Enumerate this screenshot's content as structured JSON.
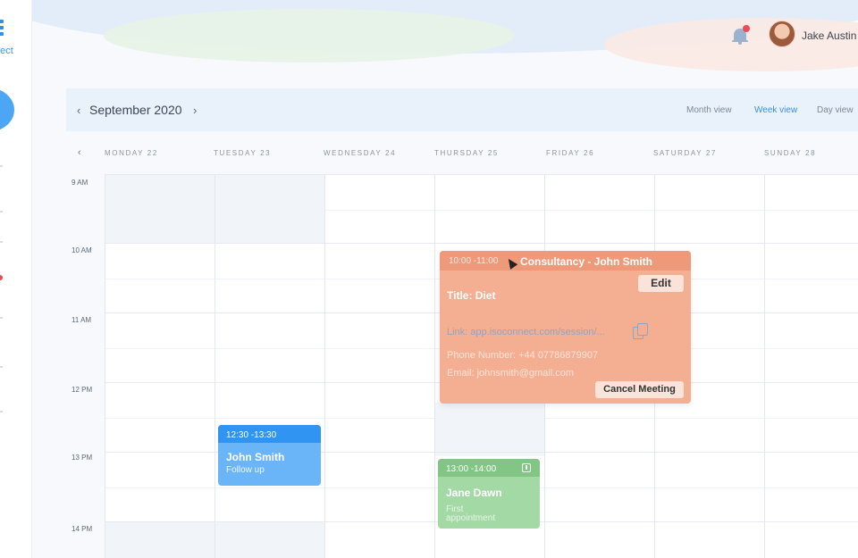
{
  "sidebar": {
    "logo_text": "nect"
  },
  "header": {
    "user_name": "Jake Austin"
  },
  "toolbar": {
    "prev_glyph": "‹",
    "month": "September 2020",
    "next_glyph": "›",
    "views": [
      "Month view",
      "Week view",
      "Day view"
    ],
    "active_view": "Week view"
  },
  "week": {
    "prev_glyph": "‹",
    "days": [
      "MONDAY 22",
      "TUESDAY 23",
      "WEDNESDAY 24",
      "THURSDAY 25",
      "FRIDAY 26",
      "SATURDAY 27",
      "SUNDAY 28"
    ]
  },
  "times": [
    "9 AM",
    "10 AM",
    "11 AM",
    "12 PM",
    "13 PM",
    "14 PM"
  ],
  "events": {
    "blue": {
      "time": "12:30 -13:30",
      "title": "John Smith",
      "subtitle": "Follow up",
      "color": "#6ab5f7"
    },
    "green": {
      "time": "13:00 -14:00",
      "title": "Jane Dawn",
      "subtitle_line1": "First",
      "subtitle_line2": "appointment",
      "color": "#a3d9a4"
    }
  },
  "popup": {
    "time": "10:00 -11:00",
    "title": "Consultancy - John Smith",
    "edit_label": "Edit",
    "detail_title": "Title: Diet",
    "link": "Link: app.isoconnect.com/session/...",
    "phone": "Phone Number: +44 07786879907",
    "email": "Email: johnsmith@gmail.com",
    "cancel_label": "Cancel Meeting",
    "color": "#f4ae92"
  },
  "icons": [
    "bell-icon",
    "copy-icon",
    "calendar-icon",
    "cursor-icon"
  ]
}
